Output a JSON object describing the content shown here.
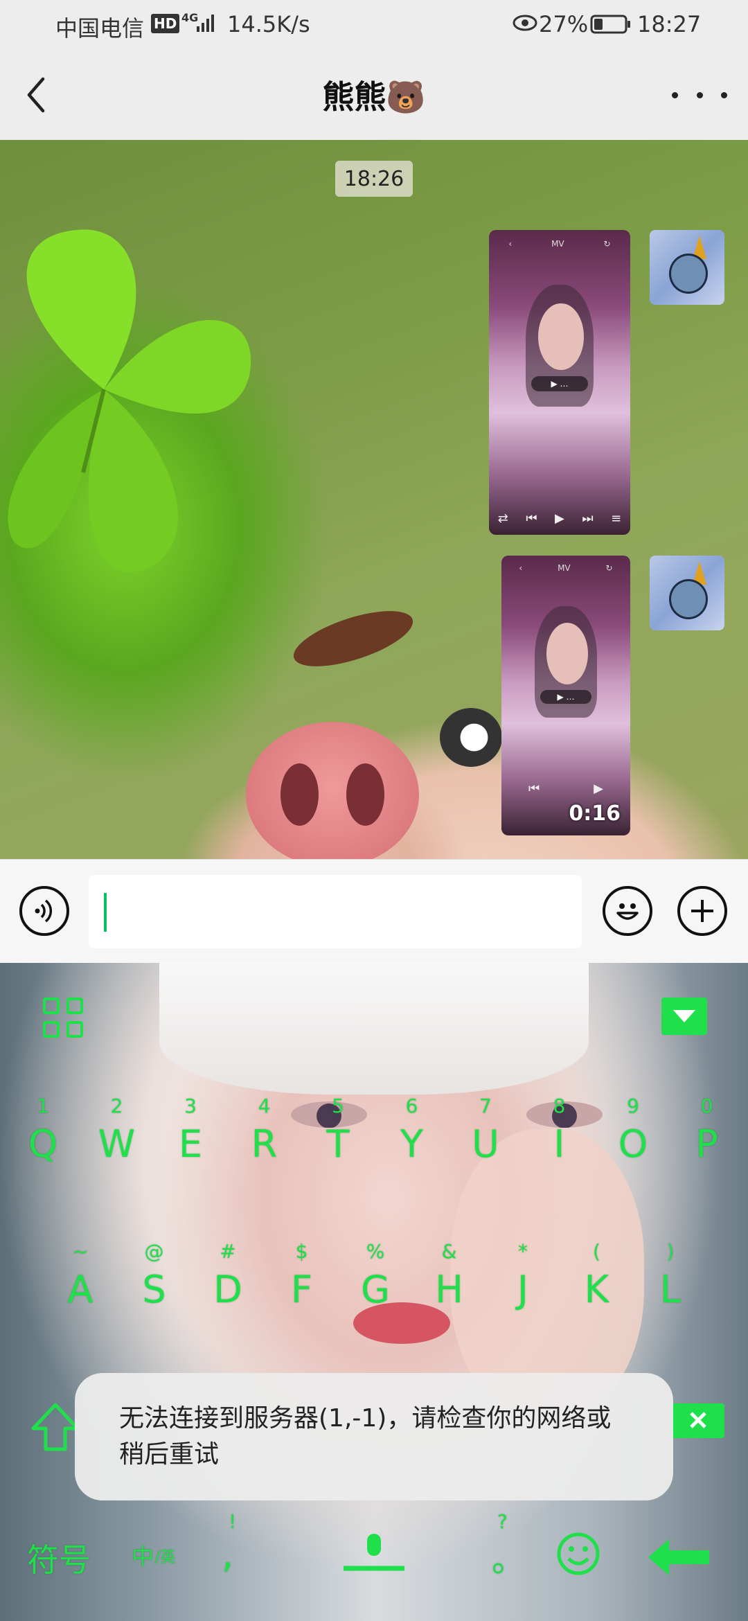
{
  "status_bar": {
    "carrier": "中国电信",
    "hd_badge": "HD",
    "network": "4G",
    "speed": "14.5K/s",
    "battery": "27%",
    "time": "18:27"
  },
  "header": {
    "title": "熊熊🐻"
  },
  "chat": {
    "timestamp": "18:26",
    "messages": [
      {
        "type": "video",
        "sender": "me"
      },
      {
        "type": "video",
        "sender": "me",
        "duration": "0:16"
      }
    ]
  },
  "input_bar": {
    "value": "",
    "placeholder": ""
  },
  "keyboard": {
    "row1_numbers": [
      "1",
      "2",
      "3",
      "4",
      "5",
      "6",
      "7",
      "8",
      "9",
      "0"
    ],
    "row1_letters": [
      "Q",
      "W",
      "E",
      "R",
      "T",
      "Y",
      "U",
      "I",
      "O",
      "P"
    ],
    "row2_symbols": [
      "~",
      "@",
      "#",
      "$",
      "%",
      "&",
      "*",
      "(",
      ")"
    ],
    "row2_letters": [
      "A",
      "S",
      "D",
      "F",
      "G",
      "H",
      "J",
      "K",
      "L"
    ],
    "symbols_key": "符号",
    "lang_key_main": "中",
    "lang_key_sub": "/英",
    "comma_key": ",",
    "comma_alt": "!",
    "period_key": "。",
    "period_alt": "?",
    "accent_color": "#1fe04a"
  },
  "toast": {
    "message": "无法连接到服务器(1,-1)，请检查你的网络或稍后重试"
  }
}
